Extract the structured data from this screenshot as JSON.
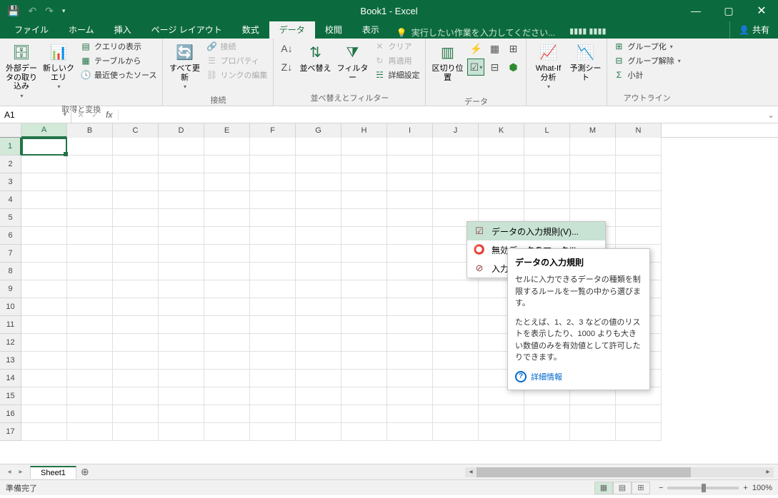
{
  "titlebar": {
    "title": "Book1 - Excel",
    "min": "—",
    "max": "▢",
    "close": "✕"
  },
  "tabs": {
    "file": "ファイル",
    "home": "ホーム",
    "insert": "挿入",
    "layout": "ページ レイアウト",
    "formulas": "数式",
    "data": "データ",
    "review": "校閲",
    "view": "表示",
    "tellme": "実行したい作業を入力してください...",
    "share": "共有"
  },
  "ribbon": {
    "get": {
      "external": "外部データの取り込み",
      "newquery": "新しいクエリ",
      "show": "クエリの表示",
      "table": "テーブルから",
      "recent": "最近使ったソース",
      "group": "取得と変換"
    },
    "conn": {
      "refresh": "すべて更新",
      "connections": "接続",
      "properties": "プロパティ",
      "editlinks": "リンクの編集",
      "group": "接続"
    },
    "sort": {
      "az": "A↓Z",
      "za": "Z↓A",
      "sort": "並べ替え",
      "filter": "フィルター",
      "clear": "クリア",
      "reapply": "再適用",
      "advanced": "詳細設定",
      "group": "並べ替えとフィルター"
    },
    "tools": {
      "texttocols": "区切り位置",
      "group": "データ"
    },
    "forecast": {
      "whatif": "What-If 分析",
      "sheet": "予測シート"
    },
    "outline": {
      "groupbtn": "グループ化",
      "ungroup": "グループ解除",
      "subtotal": "小計",
      "group": "アウトライン"
    }
  },
  "dropdown": {
    "validation": "データの入力規則(V)...",
    "circle": "無効データのマーク(I)",
    "clear": "入力規"
  },
  "tooltip": {
    "title": "データの入力規則",
    "p1": "セルに入力できるデータの種類を制限するルールを一覧の中から選びます。",
    "p2": "たとえば、1、2、3 などの値のリストを表示したり、1000 よりも大きい数値のみを有効値として許可したりできます。",
    "more": "詳細情報"
  },
  "namebox": "A1",
  "cols": [
    "A",
    "B",
    "C",
    "D",
    "E",
    "F",
    "G",
    "H",
    "I",
    "J",
    "K",
    "L",
    "M",
    "N"
  ],
  "rows": [
    1,
    2,
    3,
    4,
    5,
    6,
    7,
    8,
    9,
    10,
    11,
    12,
    13,
    14,
    15,
    16,
    17
  ],
  "sheet": "Sheet1",
  "status": {
    "ready": "準備完了",
    "zoom": "100%"
  }
}
